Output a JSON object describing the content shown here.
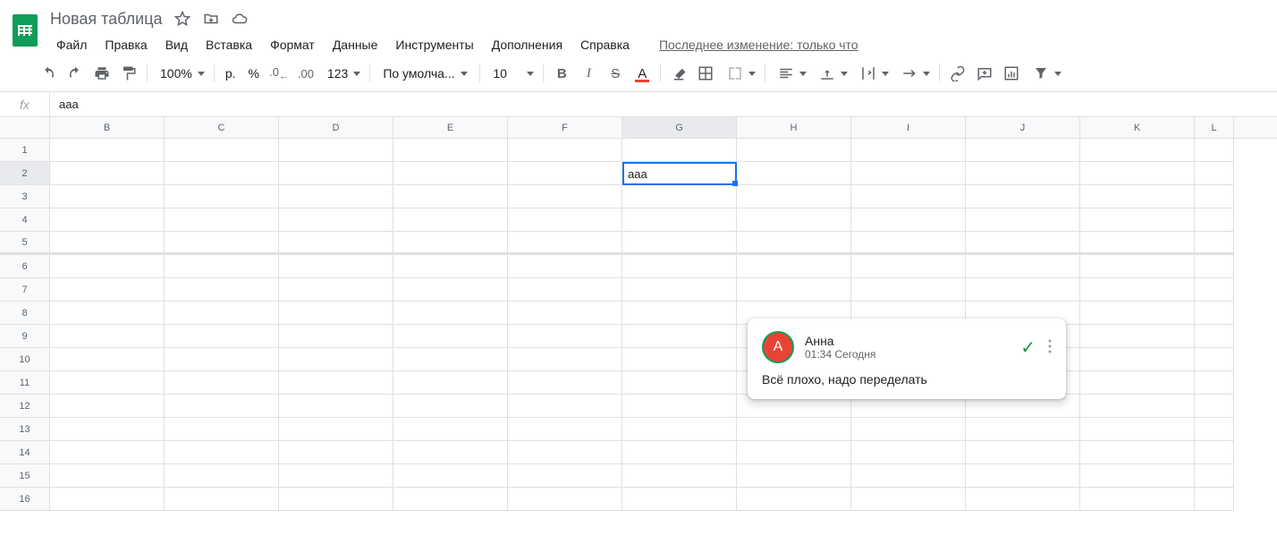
{
  "header": {
    "doc_title": "Новая таблица",
    "last_edit": "Последнее изменение: только что"
  },
  "menu": {
    "file": "Файл",
    "edit": "Правка",
    "view": "Вид",
    "insert": "Вставка",
    "format": "Формат",
    "data": "Данные",
    "tools": "Инструменты",
    "addons": "Дополнения",
    "help": "Справка"
  },
  "toolbar": {
    "zoom": "100%",
    "currency": "р.",
    "percent": "%",
    "dec_decrease": ".0",
    "dec_increase": ".00",
    "format_more": "123",
    "font": "По умолча...",
    "font_size": "10"
  },
  "formula": {
    "fx": "fx",
    "value": "ааа"
  },
  "columns": [
    "B",
    "C",
    "D",
    "E",
    "F",
    "G",
    "H",
    "I",
    "J",
    "K",
    "L"
  ],
  "rows": [
    "1",
    "2",
    "3",
    "4",
    "5",
    "6",
    "7",
    "8",
    "9",
    "10",
    "11",
    "12",
    "13",
    "14",
    "15",
    "16"
  ],
  "cell": {
    "selected_value": "ааа",
    "selected_ref": "G2"
  },
  "comment": {
    "avatar_initial": "А",
    "author": "Анна",
    "time": "01:34 Сегодня",
    "text": "Всё плохо, надо переделать"
  }
}
